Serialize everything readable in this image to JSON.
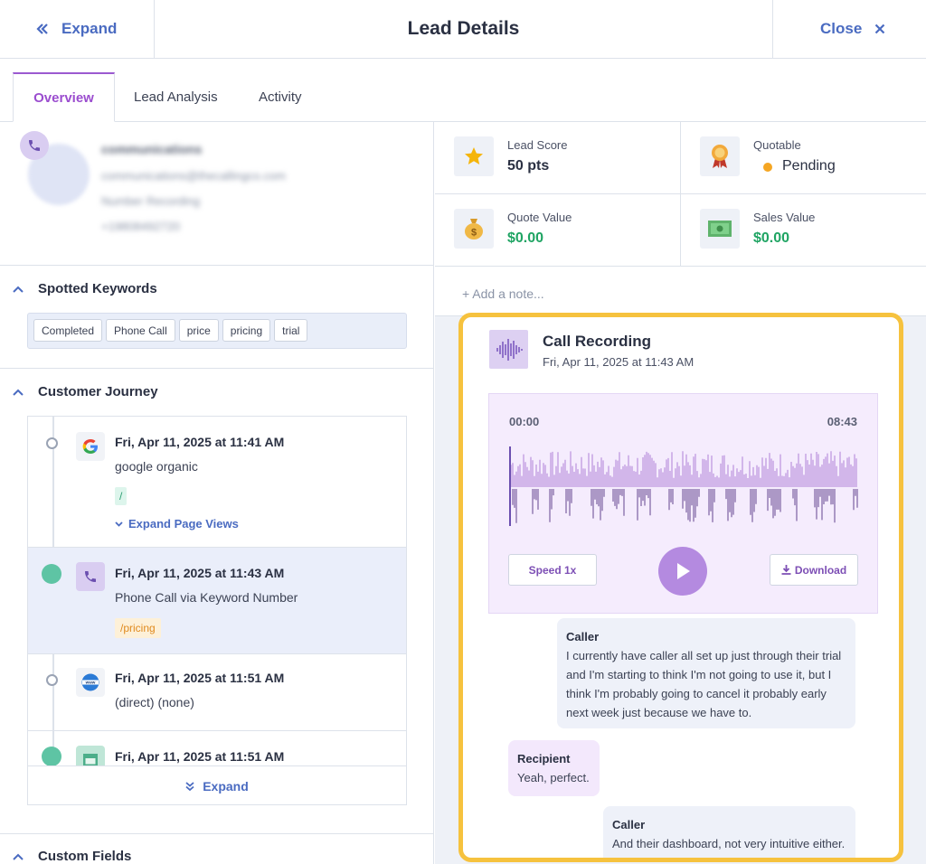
{
  "header": {
    "expand_label": "Expand",
    "title": "Lead Details",
    "close_label": "Close"
  },
  "tabs": [
    {
      "label": "Overview",
      "active": true
    },
    {
      "label": "Lead Analysis",
      "active": false
    },
    {
      "label": "Activity",
      "active": false
    }
  ],
  "contact": {
    "name": "communications",
    "email": "communications@thecallingco.com",
    "source": "Number Recording",
    "phone": "+19808492720"
  },
  "keywords": {
    "heading": "Spotted Keywords",
    "items": [
      "Completed",
      "Phone Call",
      "price",
      "pricing",
      "trial"
    ]
  },
  "journey": {
    "heading": "Customer Journey",
    "items": [
      {
        "datetime": "Fri, Apr 11, 2025 at 11:41 AM",
        "source": "google organic",
        "path": "/",
        "link": "Expand Page Views",
        "icon": "google-icon"
      },
      {
        "datetime": "Fri, Apr 11, 2025 at 11:43 AM",
        "source": "Phone Call via Keyword Number",
        "path": "/pricing",
        "icon": "phone-icon"
      },
      {
        "datetime": "Fri, Apr 11, 2025 at 11:51 AM",
        "source": "(direct) (none)",
        "icon": "www-icon"
      },
      {
        "datetime": "Fri, Apr 11, 2025 at 11:51 AM",
        "icon": "form-icon"
      }
    ],
    "expand_label": "Expand"
  },
  "custom_fields": {
    "heading": "Custom Fields"
  },
  "stats": {
    "lead_score_label": "Lead Score",
    "lead_score_value": "50 pts",
    "quotable_label": "Quotable",
    "quotable_value": "Pending",
    "quote_value_label": "Quote Value",
    "quote_value": "$0.00",
    "sales_value_label": "Sales Value",
    "sales_value": "$0.00"
  },
  "note": {
    "placeholder": "+ Add a note..."
  },
  "recording": {
    "title": "Call Recording",
    "datetime": "Fri, Apr 11, 2025 at 11:43 AM",
    "start_time": "00:00",
    "end_time": "08:43",
    "playback_position": 0,
    "speed_label": "Speed 1x",
    "download_label": "Download"
  },
  "transcript": [
    {
      "speaker": "Caller",
      "text": "I currently have caller all set up just through their trial and I'm starting to think I'm not going to use it, but I think I'm probably going to cancel it probably early next week just because we have to."
    },
    {
      "speaker": "Recipient",
      "text": "Yeah, perfect."
    },
    {
      "speaker": "Caller",
      "text": "And their dashboard, not very intuitive either."
    }
  ],
  "colors": {
    "accent": "#4a6bc1",
    "purple": "#9b4dcf",
    "green": "#1fa463",
    "highlight": "#f6c23e",
    "pending": "#f5a623"
  }
}
